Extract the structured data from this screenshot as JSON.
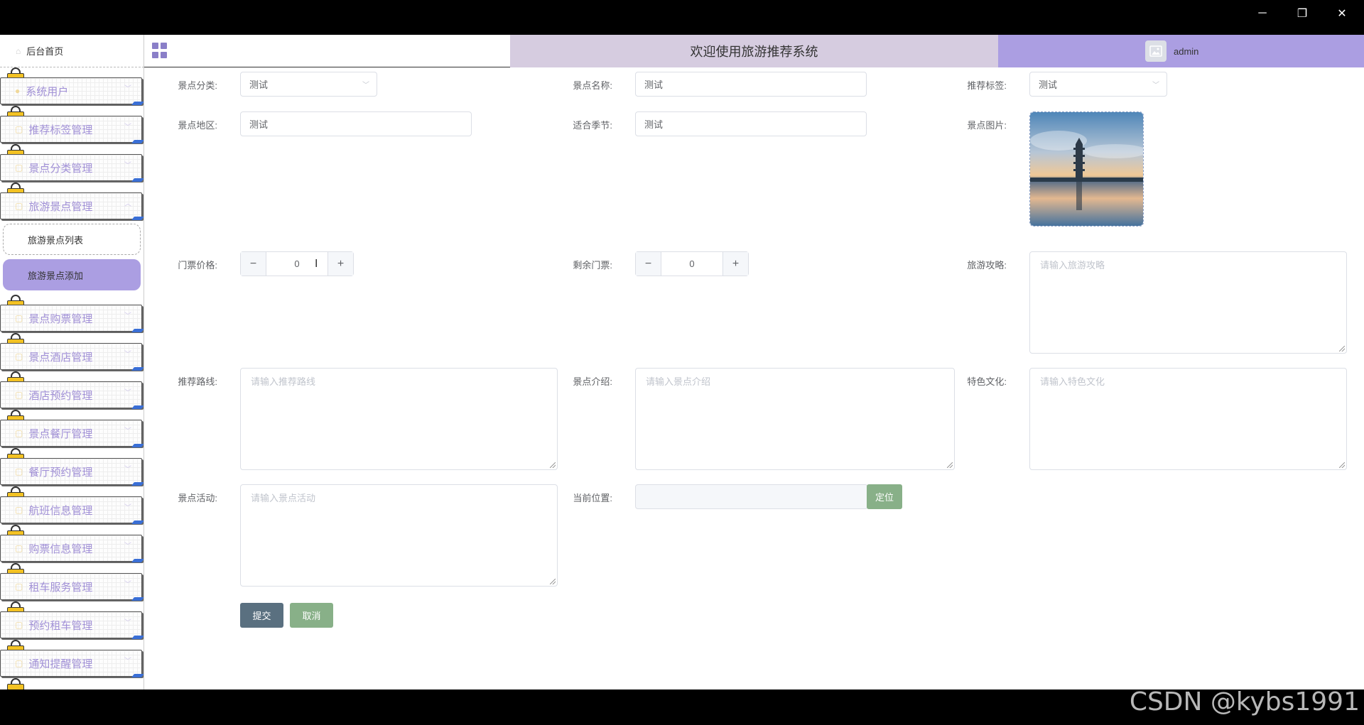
{
  "window": {
    "minimize": "─",
    "maximize": "❐",
    "close": "✕"
  },
  "header": {
    "home": "后台首页",
    "welcome": "欢迎使用旅游推荐系统",
    "username": "admin"
  },
  "sidebar": {
    "items": [
      {
        "label": "系统用户"
      },
      {
        "label": "推荐标签管理"
      },
      {
        "label": "景点分类管理"
      },
      {
        "label": "旅游景点管理"
      }
    ],
    "submenu": [
      {
        "label": "旅游景点列表"
      },
      {
        "label": "旅游景点添加"
      }
    ],
    "items_after": [
      {
        "label": "景点购票管理"
      },
      {
        "label": "景点酒店管理"
      },
      {
        "label": "酒店预约管理"
      },
      {
        "label": "景点餐厅管理"
      },
      {
        "label": "餐厅预约管理"
      },
      {
        "label": "航班信息管理"
      },
      {
        "label": "购票信息管理"
      },
      {
        "label": "租车服务管理"
      },
      {
        "label": "预约租车管理"
      },
      {
        "label": "通知提醒管理"
      }
    ]
  },
  "form": {
    "category": {
      "label": "景点分类:",
      "value": "测试"
    },
    "name": {
      "label": "景点名称:",
      "value": "测试"
    },
    "tag": {
      "label": "推荐标签:",
      "value": "测试"
    },
    "region": {
      "label": "景点地区:",
      "value": "测试"
    },
    "season": {
      "label": "适合季节:",
      "value": "测试"
    },
    "image": {
      "label": "景点图片:"
    },
    "price": {
      "label": "门票价格:",
      "value": "0"
    },
    "remaining": {
      "label": "剩余门票:",
      "value": "0"
    },
    "guide": {
      "label": "旅游攻略:",
      "placeholder": "请输入旅游攻略"
    },
    "route": {
      "label": "推荐路线:",
      "placeholder": "请输入推荐路线"
    },
    "intro": {
      "label": "景点介绍:",
      "placeholder": "请输入景点介绍"
    },
    "culture": {
      "label": "特色文化:",
      "placeholder": "请输入特色文化"
    },
    "activity": {
      "label": "景点活动:",
      "placeholder": "请输入景点活动"
    },
    "location": {
      "label": "当前位置:",
      "value": "",
      "locate_btn": "定位"
    },
    "submit": "提交",
    "cancel": "取消"
  },
  "watermark": "CSDN @kybs1991",
  "colors": {
    "accent": "#ab9ee2",
    "header_mid": "#d6cce0",
    "submit": "#5a7080",
    "cancel": "#88b088",
    "menu_text": "#a08fd6"
  }
}
